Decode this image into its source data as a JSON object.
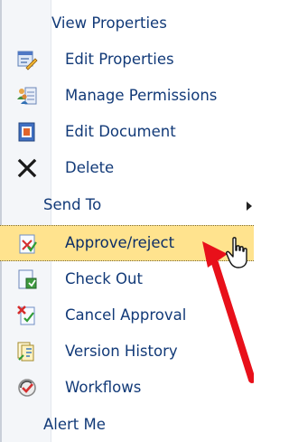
{
  "menu": {
    "items": [
      {
        "id": "view-properties",
        "label": "View Properties",
        "icon": "none"
      },
      {
        "id": "edit-properties",
        "label": "Edit Properties",
        "icon": "edit-properties-icon"
      },
      {
        "id": "manage-permissions",
        "label": "Manage Permissions",
        "icon": "manage-permissions-icon"
      },
      {
        "id": "edit-document",
        "label": "Edit Document",
        "icon": "edit-document-icon"
      },
      {
        "id": "delete",
        "label": "Delete",
        "icon": "delete-x-icon"
      },
      {
        "id": "send-to",
        "label": "Send To",
        "icon": "none",
        "submenu": true
      },
      {
        "id": "approve-reject",
        "label": "Approve/reject",
        "icon": "approve-reject-icon",
        "highlighted": true
      },
      {
        "id": "check-out",
        "label": "Check Out",
        "icon": "check-out-icon"
      },
      {
        "id": "cancel-approval",
        "label": "Cancel Approval",
        "icon": "cancel-approval-icon"
      },
      {
        "id": "version-history",
        "label": "Version History",
        "icon": "version-history-icon"
      },
      {
        "id": "workflows",
        "label": "Workflows",
        "icon": "workflows-icon"
      },
      {
        "id": "alert-me",
        "label": "Alert Me",
        "icon": "none"
      }
    ]
  },
  "annotation": {
    "arrow_color": "#e8101a",
    "pointer": "hand-cursor-icon"
  },
  "colors": {
    "highlight": "#ffe38e",
    "text": "#123a78",
    "gutter": "#f4f6f9"
  }
}
